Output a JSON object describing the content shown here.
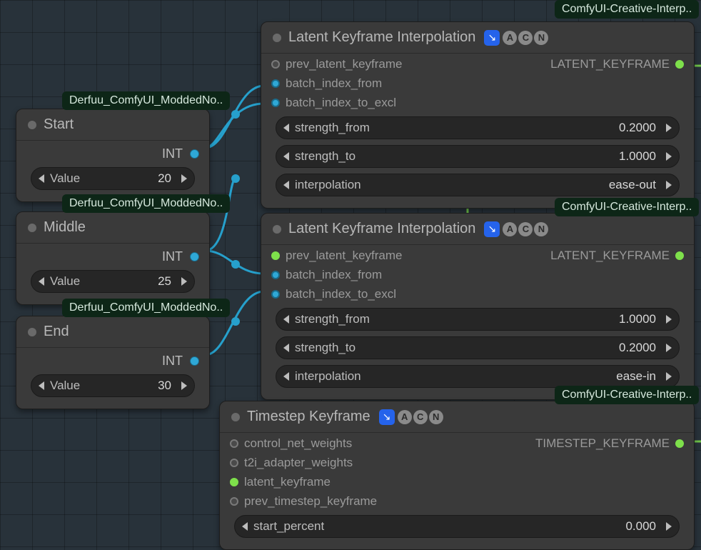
{
  "tags": {
    "derfuu": "Derfuu_ComfyUI_ModdedNo..",
    "creative": "ComfyUI-Creative-Interp.."
  },
  "nodes": {
    "start": {
      "title": "Start",
      "out_label": "INT",
      "value_label": "Value",
      "value": "20"
    },
    "middle": {
      "title": "Middle",
      "out_label": "INT",
      "value_label": "Value",
      "value": "25"
    },
    "end": {
      "title": "End",
      "out_label": "INT",
      "value_label": "Value",
      "value": "30"
    },
    "lki1": {
      "title": "Latent Keyframe Interpolation",
      "inputs": {
        "prev": "prev_latent_keyframe",
        "bif": "batch_index_from",
        "bite": "batch_index_to_excl"
      },
      "output": "LATENT_KEYFRAME",
      "widgets": {
        "strength_from_label": "strength_from",
        "strength_from_value": "0.2000",
        "strength_to_label": "strength_to",
        "strength_to_value": "1.0000",
        "interpolation_label": "interpolation",
        "interpolation_value": "ease-out"
      }
    },
    "lki2": {
      "title": "Latent Keyframe Interpolation",
      "inputs": {
        "prev": "prev_latent_keyframe",
        "bif": "batch_index_from",
        "bite": "batch_index_to_excl"
      },
      "output": "LATENT_KEYFRAME",
      "widgets": {
        "strength_from_label": "strength_from",
        "strength_from_value": "1.0000",
        "strength_to_label": "strength_to",
        "strength_to_value": "0.2000",
        "interpolation_label": "interpolation",
        "interpolation_value": "ease-in"
      }
    },
    "tk": {
      "title": "Timestep Keyframe",
      "inputs": {
        "cnw": "control_net_weights",
        "t2i": "t2i_adapter_weights",
        "lk": "latent_keyframe",
        "ptk": "prev_timestep_keyframe"
      },
      "output": "TIMESTEP_KEYFRAME",
      "widgets": {
        "start_percent_label": "start_percent",
        "start_percent_value": "0.000"
      }
    }
  },
  "acn": {
    "a": "A",
    "c": "C",
    "n": "N"
  }
}
